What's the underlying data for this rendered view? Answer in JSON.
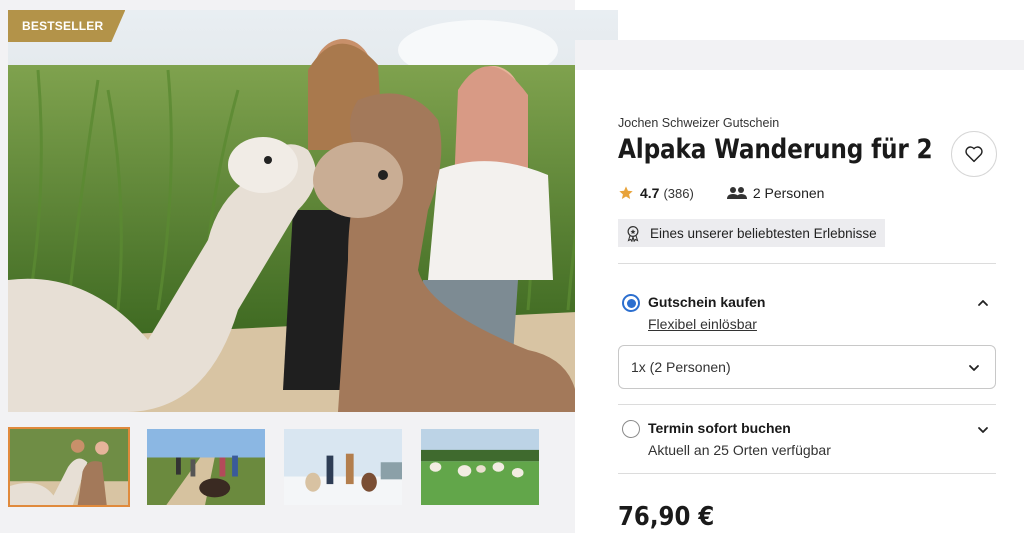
{
  "gallery": {
    "badge": "BESTSELLER",
    "hero_alt": "alpaca-walk-photo",
    "thumbnails": [
      {
        "name": "thumb-1",
        "active": true
      },
      {
        "name": "thumb-2",
        "active": false
      },
      {
        "name": "thumb-3",
        "active": false
      },
      {
        "name": "thumb-4",
        "active": false
      }
    ]
  },
  "product": {
    "brand": "Jochen Schweizer Gutschein",
    "title": "Alpaka Wanderung für 2",
    "rating": "4.7",
    "rating_count": "(386)",
    "persons": "2 Personen",
    "popular_badge": "Eines unserer beliebtesten Erlebnisse",
    "price": "76,90 €"
  },
  "options": {
    "voucher": {
      "label": "Gutschein kaufen",
      "link": "Flexibel einlösbar",
      "selected": true,
      "select_value": "1x (2 Personen)"
    },
    "booking": {
      "label": "Termin sofort buchen",
      "sub": "Aktuell an 25 Orten verfügbar",
      "selected": false
    }
  },
  "icons": {
    "favorite": "heart-icon",
    "star": "star-icon",
    "persons": "persons-icon",
    "award": "award-icon",
    "chevron_up": "chevron-up-icon",
    "chevron_down": "chevron-down-icon"
  },
  "colors": {
    "badge": "#b39349",
    "accent": "#2c6fcf",
    "star": "#e8a33a",
    "thumb_active": "#e08a3c"
  }
}
